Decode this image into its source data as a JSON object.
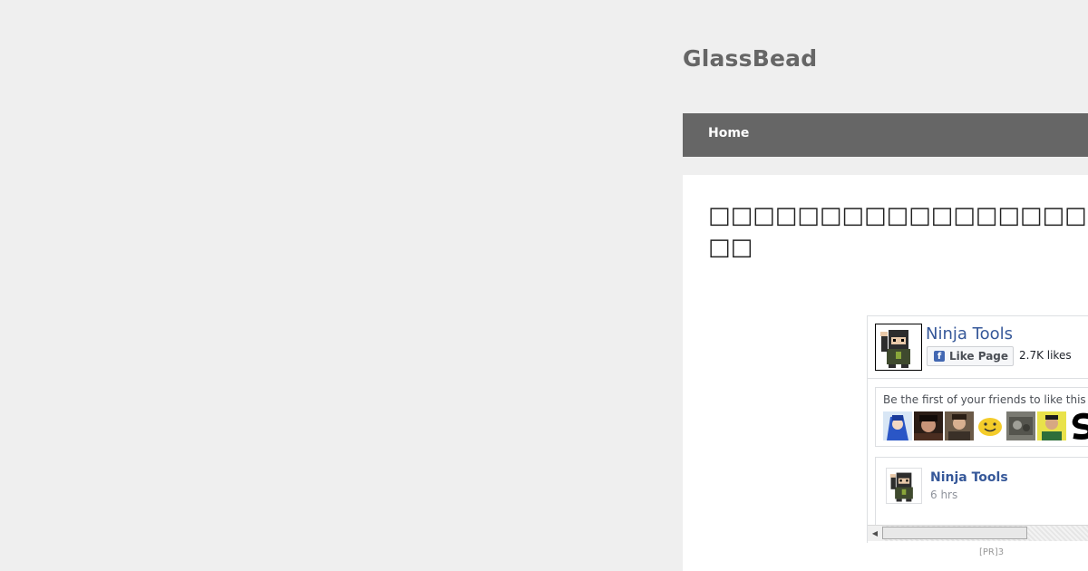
{
  "site": {
    "title": "GlassBead"
  },
  "nav": {
    "home": "Home"
  },
  "post": {
    "title_line1": "□□□□□□□□□□□□□□□□□□□□□□□□□□□by Her",
    "title_line2": "□□"
  },
  "fb_widget": {
    "page_name": "Ninja Tools",
    "like_button": "Like Page",
    "fb_icon_glyph": "f",
    "likes": "2.7K likes",
    "friends_text": "Be the first of your friends to like this",
    "post_author": "Ninja Tools",
    "post_time": "6 hrs",
    "scroll_left_glyph": "◀",
    "brand_color": "#4267b2",
    "link_color": "#365899"
  },
  "ad": {
    "label": "[PR]3"
  }
}
